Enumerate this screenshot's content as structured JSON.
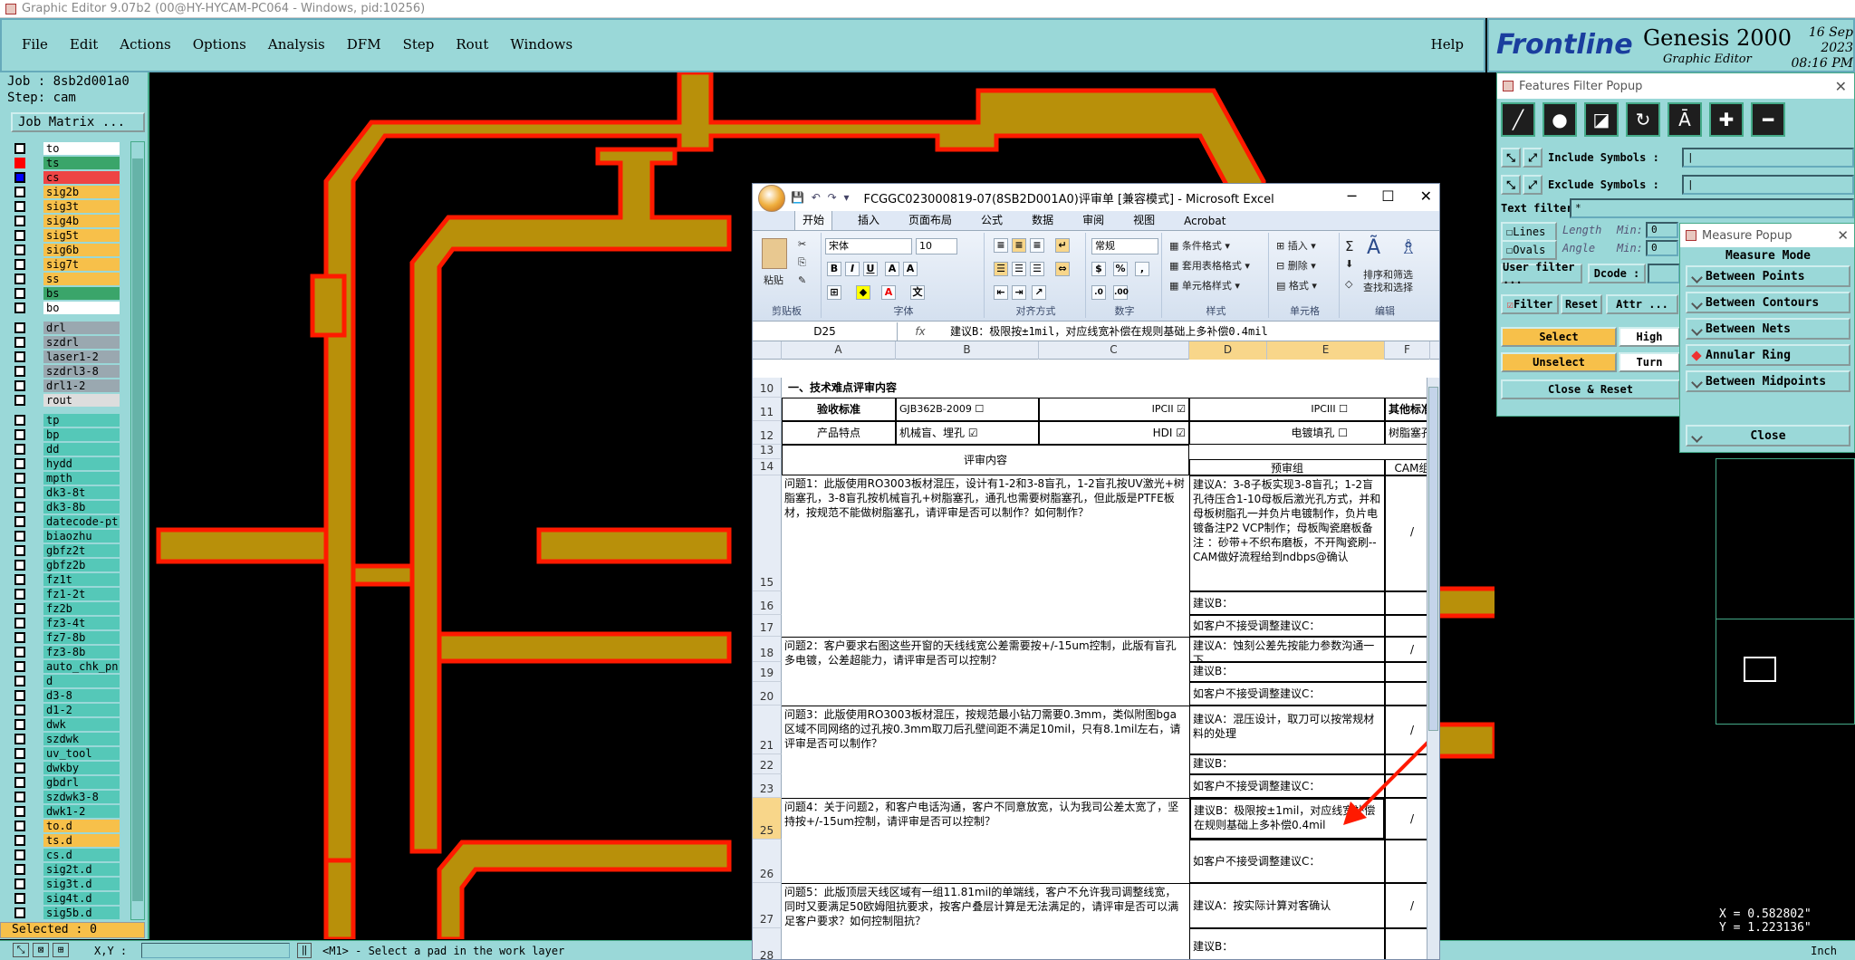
{
  "window_title": "Graphic Editor 9.07b2 (00@HY-HYCAM-PC064 - Windows, pid:10256)",
  "menu": [
    "File",
    "Edit",
    "Actions",
    "Options",
    "Analysis",
    "DFM",
    "Step",
    "Rout",
    "Windows"
  ],
  "help": "Help",
  "brand": {
    "logo": "Frontline",
    "product": "Genesis 2000",
    "subtitle": "Graphic Editor",
    "date": "16 Sep 2023",
    "time": "08:16 PM"
  },
  "left": {
    "job": "Job : 8sb2d001a0",
    "step": "Step: cam",
    "job_matrix": "Job Matrix ...",
    "selected": "Selected : 0",
    "layers": [
      {
        "name": "to",
        "color": "#ffffff",
        "cb": "white"
      },
      {
        "name": "ts",
        "color": "#3aa56a",
        "cb": "red"
      },
      {
        "name": "cs",
        "color": "#ee4444",
        "cb": "blue"
      },
      {
        "name": "sig2b",
        "color": "#f7c04a",
        "cb": "white"
      },
      {
        "name": "sig3t",
        "color": "#f7c04a",
        "cb": "white"
      },
      {
        "name": "sig4b",
        "color": "#f7c04a",
        "cb": "white"
      },
      {
        "name": "sig5t",
        "color": "#f7c04a",
        "cb": "white"
      },
      {
        "name": "sig6b",
        "color": "#f7c04a",
        "cb": "white"
      },
      {
        "name": "sig7t",
        "color": "#f7c04a",
        "cb": "white"
      },
      {
        "name": "ss",
        "color": "#f7c04a",
        "cb": "white"
      },
      {
        "name": "bs",
        "color": "#3aa56a",
        "cb": "white"
      },
      {
        "name": "bo",
        "color": "#ffffff",
        "cb": "white"
      },
      {
        "name": "drl",
        "color": "#9aa8b0",
        "cb": "white"
      },
      {
        "name": "szdrl",
        "color": "#9aa8b0",
        "cb": "white"
      },
      {
        "name": "laser1-2",
        "color": "#9aa8b0",
        "cb": "white"
      },
      {
        "name": "szdrl3-8",
        "color": "#9aa8b0",
        "cb": "white"
      },
      {
        "name": "drl1-2",
        "color": "#9aa8b0",
        "cb": "white"
      },
      {
        "name": "rout",
        "color": "#dddddd",
        "cb": "white"
      },
      {
        "name": "tp",
        "color": "#55c8b8",
        "cb": "white"
      },
      {
        "name": "bp",
        "color": "#55c8b8",
        "cb": "white"
      },
      {
        "name": "dd",
        "color": "#55c8b8",
        "cb": "white"
      },
      {
        "name": "hydd",
        "color": "#55c8b8",
        "cb": "white"
      },
      {
        "name": "mpth",
        "color": "#55c8b8",
        "cb": "white"
      },
      {
        "name": "dk3-8t",
        "color": "#55c8b8",
        "cb": "white"
      },
      {
        "name": "dk3-8b",
        "color": "#55c8b8",
        "cb": "white"
      },
      {
        "name": "datecode-pt",
        "color": "#55c8b8",
        "cb": "white"
      },
      {
        "name": "biaozhu",
        "color": "#55c8b8",
        "cb": "white"
      },
      {
        "name": "gbfz2t",
        "color": "#55c8b8",
        "cb": "white"
      },
      {
        "name": "gbfz2b",
        "color": "#55c8b8",
        "cb": "white"
      },
      {
        "name": "fz1t",
        "color": "#55c8b8",
        "cb": "white"
      },
      {
        "name": "fz1-2t",
        "color": "#55c8b8",
        "cb": "white"
      },
      {
        "name": "fz2b",
        "color": "#55c8b8",
        "cb": "white"
      },
      {
        "name": "fz3-4t",
        "color": "#55c8b8",
        "cb": "white"
      },
      {
        "name": "fz7-8b",
        "color": "#55c8b8",
        "cb": "white"
      },
      {
        "name": "fz3-8b",
        "color": "#55c8b8",
        "cb": "white"
      },
      {
        "name": "auto_chk_pn",
        "color": "#55c8b8",
        "cb": "white"
      },
      {
        "name": "d",
        "color": "#55c8b8",
        "cb": "white"
      },
      {
        "name": "d3-8",
        "color": "#55c8b8",
        "cb": "white"
      },
      {
        "name": "d1-2",
        "color": "#55c8b8",
        "cb": "white"
      },
      {
        "name": "dwk",
        "color": "#55c8b8",
        "cb": "white"
      },
      {
        "name": "szdwk",
        "color": "#55c8b8",
        "cb": "white"
      },
      {
        "name": "uv_tool",
        "color": "#55c8b8",
        "cb": "white"
      },
      {
        "name": "dwkby",
        "color": "#55c8b8",
        "cb": "white"
      },
      {
        "name": "gbdrl",
        "color": "#55c8b8",
        "cb": "white"
      },
      {
        "name": "szdwk3-8",
        "color": "#55c8b8",
        "cb": "white"
      },
      {
        "name": "dwk1-2",
        "color": "#55c8b8",
        "cb": "white"
      },
      {
        "name": "to.d",
        "color": "#f7c04a",
        "cb": "white"
      },
      {
        "name": "ts.d",
        "color": "#f7c04a",
        "cb": "white"
      },
      {
        "name": "cs.d",
        "color": "#55c8b8",
        "cb": "white"
      },
      {
        "name": "sig2t.d",
        "color": "#55c8b8",
        "cb": "white"
      },
      {
        "name": "sig3t.d",
        "color": "#55c8b8",
        "cb": "white"
      },
      {
        "name": "sig4t.d",
        "color": "#55c8b8",
        "cb": "white"
      },
      {
        "name": "sig5b.d",
        "color": "#55c8b8",
        "cb": "white"
      }
    ]
  },
  "status": {
    "xy_label": "X,Y :",
    "message": "<M1> - Select a pad in the work layer",
    "unit": "Inch"
  },
  "features_filter": {
    "title": "Features Filter Popup",
    "include_label": "Include Symbols :",
    "exclude_label": "Exclude Symbols :",
    "text_filter_label": "Text filter",
    "text_filter_value": "*",
    "lines": "Lines",
    "ovals": "Ovals",
    "length": "Length",
    "angle": "Angle",
    "min1": "Min:",
    "min2": "Min:",
    "min_val1": "0",
    "min_val2": "0",
    "user_filter": "User filter ...",
    "dcode": "Dcode :",
    "filter": "Filter",
    "reset": "Reset",
    "attr": "Attr ...",
    "select": "Select",
    "unselect": "Unselect",
    "highlight": "High",
    "turn": "Turn",
    "close_reset": "Close & Reset"
  },
  "measure": {
    "title": "Measure Popup",
    "mode": "Measure Mode",
    "items": [
      "Between Points",
      "Between Contours",
      "Between Nets",
      "Annular Ring",
      "Between Midpoints"
    ],
    "selected": "Annular Ring",
    "close": "Close"
  },
  "coords": {
    "x": "X = 0.582802\"",
    "y": "Y = 1.223136\""
  },
  "excel": {
    "title": "FCGGC023000819-07(8SB2D001A0)评审单  [兼容模式] - Microsoft Excel",
    "tabs": [
      "开始",
      "插入",
      "页面布局",
      "公式",
      "数据",
      "审阅",
      "视图",
      "Acrobat"
    ],
    "ribbon": {
      "paste": "粘贴",
      "clipboard": "剪贴板",
      "font_name": "宋体",
      "font_size": "10",
      "font": "字体",
      "alignment": "对齐方式",
      "number_fmt": "常规",
      "number": "数字",
      "cond_fmt": "条件格式",
      "table_fmt": "套用表格格式",
      "cell_style": "单元格样式",
      "styles": "样式",
      "insert": "插入",
      "delete": "删除",
      "format": "格式",
      "cells": "单元格",
      "sort": "排序和筛选",
      "find": "查找和选择",
      "editing": "编辑"
    },
    "name_box": "D25",
    "formula": "建议B：极限按±1mil，对应线宽补偿在规则基础上多补偿0.4mil",
    "columns": [
      "A",
      "B",
      "C",
      "D",
      "E",
      "F"
    ],
    "rows": {
      "r10": "一、技术难点评审内容",
      "r11_a": "验收标准",
      "r11_b": "GJB362B-2009 ☐",
      "r11_c": "IPCII ☑",
      "r11_e": "IPCIII ☐",
      "r11_f": "其他标准",
      "r12_a": "产品特点",
      "r12_b": "机械盲、埋孔 ☑",
      "r12_c": "HDI ☑",
      "r12_e": "电镀填孔 ☐",
      "r12_f": "树脂塞孔",
      "r13_review": "评审内容",
      "r14_pre": "预审组",
      "r14_cam": "CAM组",
      "q1": "问题1：此版使用RO3003板材混压，设计有1-2和3-8盲孔，1-2盲孔按UV激光+树脂塞孔，3-8盲孔按机械盲孔+树脂塞孔，通孔也需要树脂塞孔，但此版是PTFE板材，按规范不能做树脂塞孔，请评审是否可以制作？如何制作？",
      "q1_a": "建议A：3-8子板实现3-8盲孔；1-2盲孔待压合1-10母板后激光孔方式，并和母板树脂孔一并负片电镀制作，负片电镀备注P2 VCP制作；母板陶瓷磨板备注 ：砂带+不织布磨板，不开陶瓷刷--CAM做好流程给到ndbps@确认",
      "q1_b": "建议B：",
      "q1_c": "如客户不接受调整建议C：",
      "q2": "问题2：客户要求右图这些开窗的天线线宽公差需要按+/-15um控制，此版有盲孔多电镀，公差超能力，请评审是否可以控制？",
      "q2_a": "建议A：蚀刻公差先按能力参数沟通一下",
      "q2_b": "建议B：",
      "q2_c": "如客户不接受调整建议C：",
      "q3": "问题3：此版使用RO3003板材混压，按规范最小钻刀需要0.3mm，类似附图bga区域不同网络的过孔按0.3mm取刀后孔壁间距不满足10mil，只有8.1mil左右，请评审是否可以制作？",
      "q3_a": "建议A：混压设计，取刀可以按常规材料的处理",
      "q3_b": "建议B：",
      "q3_c": "如客户不接受调整建议C：",
      "q4": "问题4：关于问题2，和客户电话沟通，客户不同意放宽，认为我司公差太宽了，坚持按+/-15um控制，请评审是否可以控制？",
      "q4_b": "建议B：极限按±1mil，对应线宽补偿在规则基础上多补偿0.4mil",
      "q4_c": "如客户不接受调整建议C：",
      "q5": "问题5：此版顶层天线区域有一组11.81mil的单端线，客户不允许我司调整线宽，同时又要满足50欧姆阻抗要求，按客户叠层计算是无法满足的，请评审是否可以满足客户要求？如何控制阻抗？",
      "q5_a": "建议A：按实际计算对客确认",
      "q5_b": "建议B：",
      "slash": "/"
    }
  },
  "colors": {
    "panel": "#9ad8d8",
    "copper": "#b8900a",
    "outline": "#ff1a00",
    "highlight": "#f7c04a"
  }
}
